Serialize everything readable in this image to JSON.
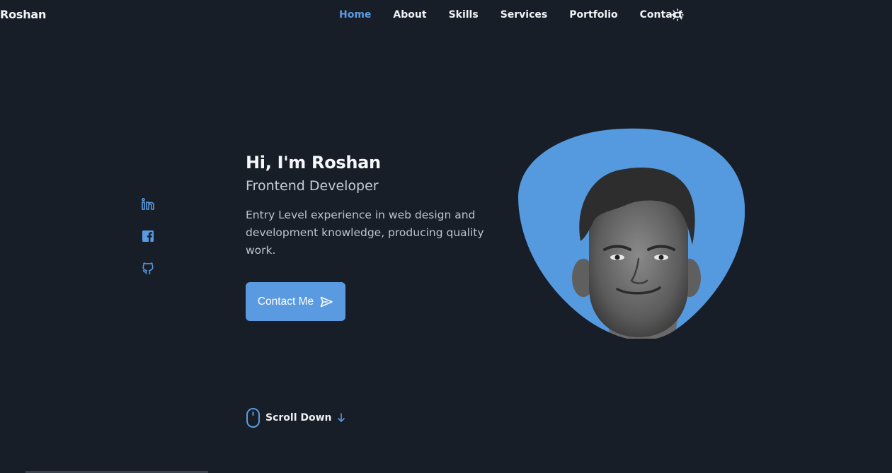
{
  "header": {
    "brand": "Roshan",
    "nav": [
      {
        "label": "Home",
        "active": true
      },
      {
        "label": "About",
        "active": false
      },
      {
        "label": "Skills",
        "active": false
      },
      {
        "label": "Services",
        "active": false
      },
      {
        "label": "Portfolio",
        "active": false
      },
      {
        "label": "Contact",
        "active": false
      }
    ],
    "theme_toggle_icon": "sun-icon"
  },
  "social": [
    {
      "name": "linkedin-icon"
    },
    {
      "name": "facebook-icon"
    },
    {
      "name": "github-icon"
    }
  ],
  "hero": {
    "title": "Hi, I'm Roshan",
    "subtitle": "Frontend Developer",
    "description": "Entry Level experience in web design and development knowledge, producing quality work.",
    "button_label": "Contact Me",
    "button_icon": "send-icon"
  },
  "scroll": {
    "label": "Scroll Down",
    "mouse_icon": "mouse-icon",
    "arrow_icon": "arrow-down-icon"
  },
  "colors": {
    "background": "#171e28",
    "accent": "#5a9ae0",
    "text": "#f1f3f5",
    "muted": "#bfc4cb"
  }
}
